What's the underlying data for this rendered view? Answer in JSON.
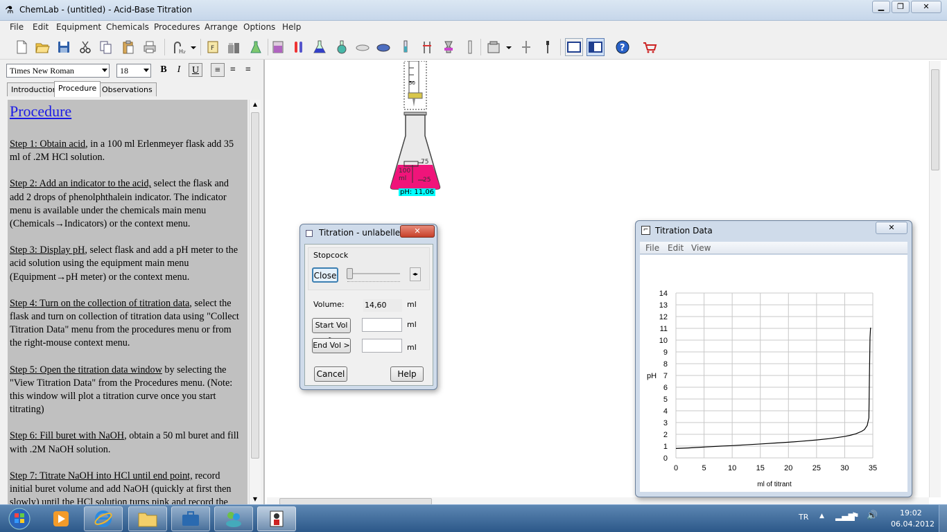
{
  "window": {
    "title": "ChemLab - (untitled) - Acid-Base Titration",
    "icon": "chemlab-app-icon"
  },
  "menu": [
    "File",
    "Edit",
    "Equipment",
    "Chemicals",
    "Procedures",
    "Arrange",
    "Options",
    "Help"
  ],
  "toolbar": {
    "icons": [
      "new-file-icon",
      "open-folder-icon",
      "save-icon",
      "cut-icon",
      "copy-icon",
      "paste-icon",
      "print-icon",
      "water-tap-icon",
      "dropdown-icon",
      "filter-funnel-icon",
      "chemical-bottles-icon",
      "flask-bottle-icon",
      "beaker-icon",
      "test-tubes-icon",
      "erlenmeyer-flask-icon",
      "round-flask-icon",
      "evaporating-dish-icon",
      "petri-dish-icon",
      "buret-icon",
      "ring-stand-icon",
      "bunsen-burner-icon",
      "graduated-cylinder-icon",
      "balance-icon",
      "dropdown-icon",
      "stirrer-icon",
      "dropper-icon",
      "single-pane-view-icon",
      "split-pane-view-icon",
      "help-icon",
      "shopping-cart-icon"
    ]
  },
  "format": {
    "font": "Times New Roman",
    "size": "18",
    "bold": "B",
    "italic": "I",
    "underline": "U"
  },
  "tabs": [
    {
      "label": "Introduction"
    },
    {
      "label": "Procedure"
    },
    {
      "label": "Observations"
    }
  ],
  "doc": {
    "title": "Procedure",
    "steps": [
      {
        "heading": "Step 1: Obtain acid",
        "text": ", in a 100 ml Erlenmeyer flask add 35 ml of  .2M  HCl solution."
      },
      {
        "heading": "Step 2: Add an indicator to the acid,",
        "text": " select the flask and add 2 drops of phenolphthalein indicator. The indicator menu is available under the chemicals main menu (Chemicals→Indicators) or the context menu."
      },
      {
        "heading": "Step 3:  Display pH",
        "text": ", select flask and add a pH meter to the acid solution using the equipment main menu (Equipment→pH meter) or the context menu."
      },
      {
        "heading": "Step 4:  Turn on the collection of titration data",
        "text": ", select the flask and turn on collection of titration data using \"Collect Titration Data\" menu from the procedures menu or from the right-mouse context menu."
      },
      {
        "heading": "Step 5: Open the titration data window",
        "text": " by selecting the \"View Titration Data\" from the Procedures menu. (Note: this window will plot a titration curve once you start titrating)"
      },
      {
        "heading": "Step 6: Fill buret with NaOH",
        "text": ", obtain a 50 ml buret and fill with .2M NaOH solution."
      },
      {
        "heading": "Step 7: Titrate NaOH into HCl until end point,",
        "text": " record initial buret volume and add NaOH  (quickly at first then slowly) until the HCl solution turns pink and record the"
      }
    ]
  },
  "lab": {
    "buret_mark": "50",
    "flask_labels": [
      "100",
      "ml",
      "75",
      "25"
    ],
    "ph_readout": "pH: 11,06",
    "colors": {
      "solution": "#f0147a",
      "ph_label_bg": "#00ffff"
    }
  },
  "titration_dialog": {
    "title": "Titration - unlabelled",
    "close_x": "✕",
    "group": "Stopcock",
    "close_btn": "Close",
    "volume_label": "Volume:",
    "volume_value": "14,60",
    "unit": "ml",
    "start_btn": "Start Vol >",
    "end_btn": "End Vol >",
    "start_value": "",
    "end_value": "",
    "cancel": "Cancel",
    "help": "Help"
  },
  "data_window": {
    "title": "Titration Data",
    "close_x": "✕",
    "menu": [
      "File",
      "Edit",
      "View"
    ]
  },
  "chart_data": {
    "type": "line",
    "xlabel": "ml of titrant",
    "ylabel": "pH",
    "xlim": [
      0,
      35
    ],
    "ylim": [
      0,
      14
    ],
    "xticks": [
      0,
      5,
      10,
      15,
      20,
      25,
      30,
      35
    ],
    "yticks": [
      0,
      1,
      2,
      3,
      4,
      5,
      6,
      7,
      8,
      9,
      10,
      11,
      12,
      13,
      14
    ],
    "grid": true,
    "series": [
      {
        "x": [
          0,
          2,
          5,
          8,
          10,
          12,
          15,
          18,
          20,
          22,
          25,
          27,
          28,
          30,
          31,
          32,
          33,
          33.5,
          34,
          34.3,
          34.4,
          34.5,
          34.6
        ],
        "y": [
          0.8,
          0.84,
          0.92,
          1.0,
          1.04,
          1.1,
          1.18,
          1.27,
          1.33,
          1.4,
          1.52,
          1.62,
          1.68,
          1.82,
          1.92,
          2.05,
          2.25,
          2.4,
          2.75,
          3.4,
          7.0,
          10.2,
          11.06
        ],
        "color": "#000000"
      }
    ]
  },
  "taskbar": {
    "apps": [
      "start-orb-icon",
      "media-player-icon",
      "internet-explorer-icon",
      "file-explorer-icon",
      "briefcase-icon",
      "messenger-icon",
      "chemlab-taskbar-icon"
    ],
    "lang": "TR",
    "time": "19:02",
    "date": "06.04.2012"
  }
}
